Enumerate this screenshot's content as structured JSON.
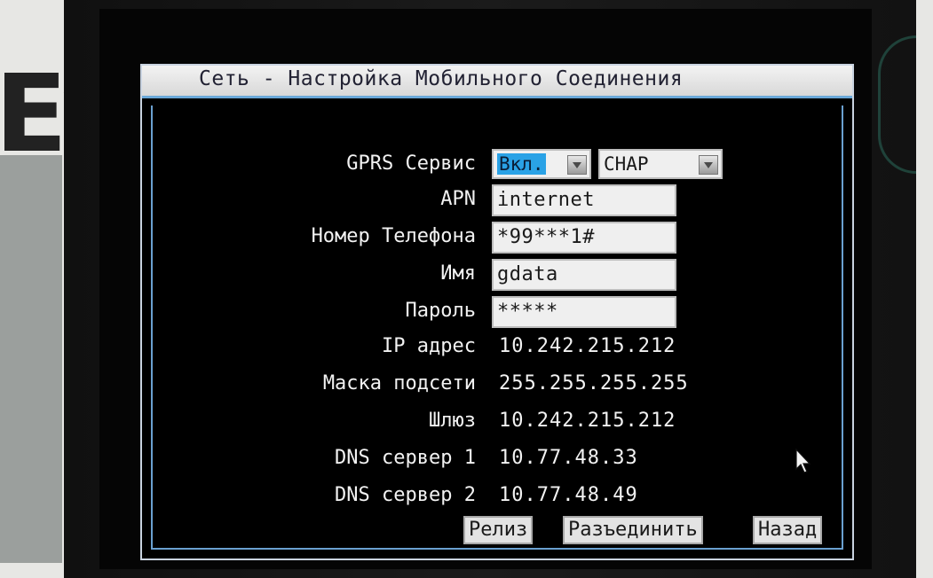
{
  "dialog": {
    "title": "Сеть - Настройка Мобильного Соединения"
  },
  "form": {
    "gprs_label": "GPRS Сервис",
    "gprs_value": "Вкл.",
    "auth_value": "CHAP",
    "apn_label": "APN",
    "apn_value": "internet",
    "phone_label": "Номер Телефона",
    "phone_value": "*99***1#",
    "name_label": "Имя",
    "name_value": "gdata",
    "password_label": "Пароль",
    "password_value": "*****",
    "ip_label": "IP адрес",
    "ip_value": "10.242.215.212",
    "mask_label": "Маска подсети",
    "mask_value": "255.255.255.255",
    "gateway_label": "Шлюз",
    "gateway_value": "10.242.215.212",
    "dns1_label": "DNS сервер 1",
    "dns1_value": "10.77.48.33",
    "dns2_label": "DNS сервер 2",
    "dns2_value": "10.77.48.49"
  },
  "buttons": {
    "release": "Релиз",
    "disconnect": "Разъединить",
    "back": "Назад"
  },
  "icons": {
    "dropdown": "chevron-down-icon",
    "cursor": "mouse-pointer-icon"
  }
}
